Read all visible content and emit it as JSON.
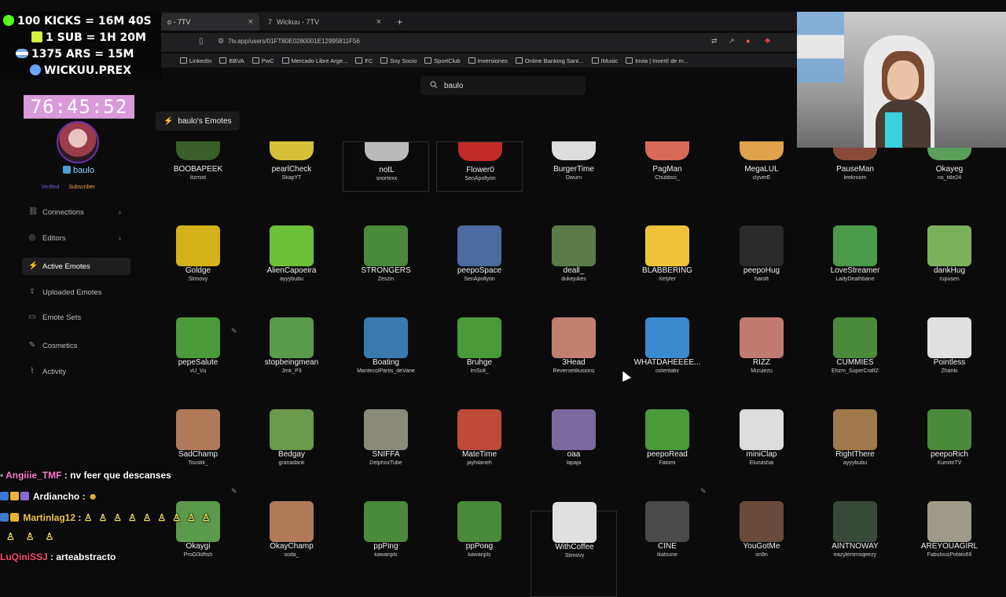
{
  "browser": {
    "tabs": [
      {
        "label": "o - 7TV",
        "active": true
      },
      {
        "label": "Wickuu - 7TV",
        "active": false
      }
    ],
    "new_tab": "+",
    "close_tab": "×",
    "url": "7tv.app/users/01FT80E0280001E12995811F56",
    "bookmarks": [
      "LinkedIn",
      "BBVA",
      "PwC",
      "Mercado Libre Arge...",
      "FC",
      "Soy Socio",
      "SportClub",
      "Inversiones",
      "Online Banking Sant...",
      "IMusic",
      "Invia | Invertí de m..."
    ]
  },
  "search": {
    "value": "baulo"
  },
  "page_title": "baulo's Emotes",
  "user": {
    "name": "baulo",
    "roles": [
      "Verified",
      "Subscriber"
    ]
  },
  "nav": {
    "items": [
      {
        "label": "Connections",
        "icon": "link-icon",
        "chevron": true,
        "active": false
      },
      {
        "label": "Editors",
        "icon": "editor-icon",
        "chevron": true,
        "active": false
      },
      {
        "label": "Active Emotes",
        "icon": "bolt-icon",
        "chevron": false,
        "active": true
      },
      {
        "label": "Uploaded Emotes",
        "icon": "upload-icon",
        "chevron": false,
        "active": false
      },
      {
        "label": "Emote Sets",
        "icon": "folder-icon",
        "chevron": false,
        "active": false
      },
      {
        "label": "Cosmetics",
        "icon": "brush-icon",
        "chevron": false,
        "active": false
      },
      {
        "label": "Activity",
        "icon": "activity-icon",
        "chevron": false,
        "active": false
      }
    ]
  },
  "emotes": [
    [
      {
        "name": "BOOBAPEEK",
        "owner": "Itzmist",
        "color": "#3a5f2a"
      },
      {
        "name": "pearlCheck",
        "owner": "SkapYT",
        "color": "#d6c23a"
      },
      {
        "name": "notL",
        "owner": "snortexx",
        "color": "#bbbbbb"
      },
      {
        "name": "Flower0",
        "owner": "SenApollyon",
        "color": "#c02a2a"
      },
      {
        "name": "BurgerTime",
        "owner": "Dwurn",
        "color": "#dddddd"
      },
      {
        "name": "PagMan",
        "owner": "Chubbss_",
        "color": "#d86a5a"
      },
      {
        "name": "MegaLUL",
        "owner": "clyverE",
        "color": "#e0a24a"
      },
      {
        "name": "PauseMan",
        "owner": "leekroom",
        "color": "#8a4a3a"
      },
      {
        "name": "Okayeg",
        "owner": "no_title24",
        "color": "#5aa05a"
      }
    ],
    [
      {
        "name": "Goldge",
        "owner": "Slimovy",
        "color": "#d6b21a"
      },
      {
        "name": "AlienCapoeira",
        "owner": "ayyybubu",
        "color": "#6bc23a"
      },
      {
        "name": "STRONGERS",
        "owner": "Zeszin",
        "color": "#4a8a3a"
      },
      {
        "name": "peepoSpace",
        "owner": "SenApollyon",
        "color": "#4a6aa0"
      },
      {
        "name": "deall_",
        "owner": "dukejukes",
        "color": "#5a7a4a"
      },
      {
        "name": "BLABBERING",
        "owner": "Xelyfer",
        "color": "#f0c23a"
      },
      {
        "name": "peepoHug",
        "owner": "harott",
        "color": "#2a2a2a"
      },
      {
        "name": "LoveStreamer",
        "owner": "LadyDeathbane",
        "color": "#4a9a4a"
      },
      {
        "name": "dankHug",
        "owner": "rupusen",
        "color": "#7ab05a"
      }
    ],
    [
      {
        "name": "pepeSalute",
        "owner": "vU_Vu",
        "color": "#4a9a3a"
      },
      {
        "name": "stopbeingmean",
        "owner": "Jmk_P3",
        "color": "#5a9a4a"
      },
      {
        "name": "Boating",
        "owner": "MantecolPartis_deVane",
        "color": "#3a7ab0"
      },
      {
        "name": "Bruhge",
        "owner": "ImSoll_",
        "color": "#4a9a3a"
      },
      {
        "name": "3Head",
        "owner": "Reversetiliusions",
        "color": "#c08070"
      },
      {
        "name": "WHATDAHEEEE...",
        "owner": "ostentativ",
        "color": "#3a8ad0"
      },
      {
        "name": "RIZZ",
        "owner": "Mizuiezu",
        "color": "#c07a70"
      },
      {
        "name": "CUMMIES",
        "owner": "Ehzm_SuperCraftZ",
        "color": "#4a8a3a"
      },
      {
        "name": "Pointless",
        "owner": "Zhanki",
        "color": "#e0e0e0"
      }
    ],
    [
      {
        "name": "SadChamp",
        "owner": "Toustik_",
        "color": "#b07a5a"
      },
      {
        "name": "Bedgay",
        "owner": "granadank",
        "color": "#6a9a4a"
      },
      {
        "name": "SNIFFA",
        "owner": "DelphoxTube",
        "color": "#8a8a7a"
      },
      {
        "name": "MateTime",
        "owner": "jayhilaneh",
        "color": "#c04a3a"
      },
      {
        "name": "oaa",
        "owner": "lapaja",
        "color": "#7a6aa0"
      },
      {
        "name": "peepoRead",
        "owner": "Falomi",
        "color": "#4a9a3a"
      },
      {
        "name": "miniClap",
        "owner": "Elunashai",
        "color": "#dddddd"
      },
      {
        "name": "RightThere",
        "owner": "ayyybubu",
        "color": "#a07a4a"
      },
      {
        "name": "peepoRich",
        "owner": "KumitoTV",
        "color": "#4a8a3a"
      }
    ],
    [
      {
        "name": "Okaygi",
        "owner": "ProG0ldfish",
        "color": "#5a9a4a"
      },
      {
        "name": "OkayChamp",
        "owner": "soda_",
        "color": "#b07a5a"
      },
      {
        "name": "ppPing",
        "owner": "kawanpls",
        "color": "#4a8a3a"
      },
      {
        "name": "ppPong",
        "owner": "kawanpls",
        "color": "#4a8a3a"
      },
      {
        "name": "WithCoffee",
        "owner": "Slimovy",
        "color": "#e0e0e0"
      },
      {
        "name": "CINE",
        "owner": "ikatsune",
        "color": "#4a4a4a"
      },
      {
        "name": "YouGotMe",
        "owner": "on9n",
        "color": "#6a4a3a"
      },
      {
        "name": "AINTNOWAY",
        "owner": "eazylemmsqeezy",
        "color": "#3a4a3a"
      },
      {
        "name": "AREYOUAGIRL",
        "owner": "FabulousPotato69",
        "color": "#a09a8a"
      }
    ]
  ],
  "overlay": {
    "goals": [
      "100 KICKS = 16M 40S",
      "1 SUB = 1H 20M",
      "1375 ARS = 15M",
      "WICKUU.PREX"
    ],
    "timer": "76:45:52"
  },
  "chat": [
    {
      "user": "Angiiie_TMF",
      "message": "nv feer que descanses"
    },
    {
      "user": "Ardiancho",
      "message": ""
    },
    {
      "user": "Martinlag12",
      "message": ""
    },
    {
      "user": "LuQiniSSJ",
      "message": "arteabstracto"
    }
  ]
}
